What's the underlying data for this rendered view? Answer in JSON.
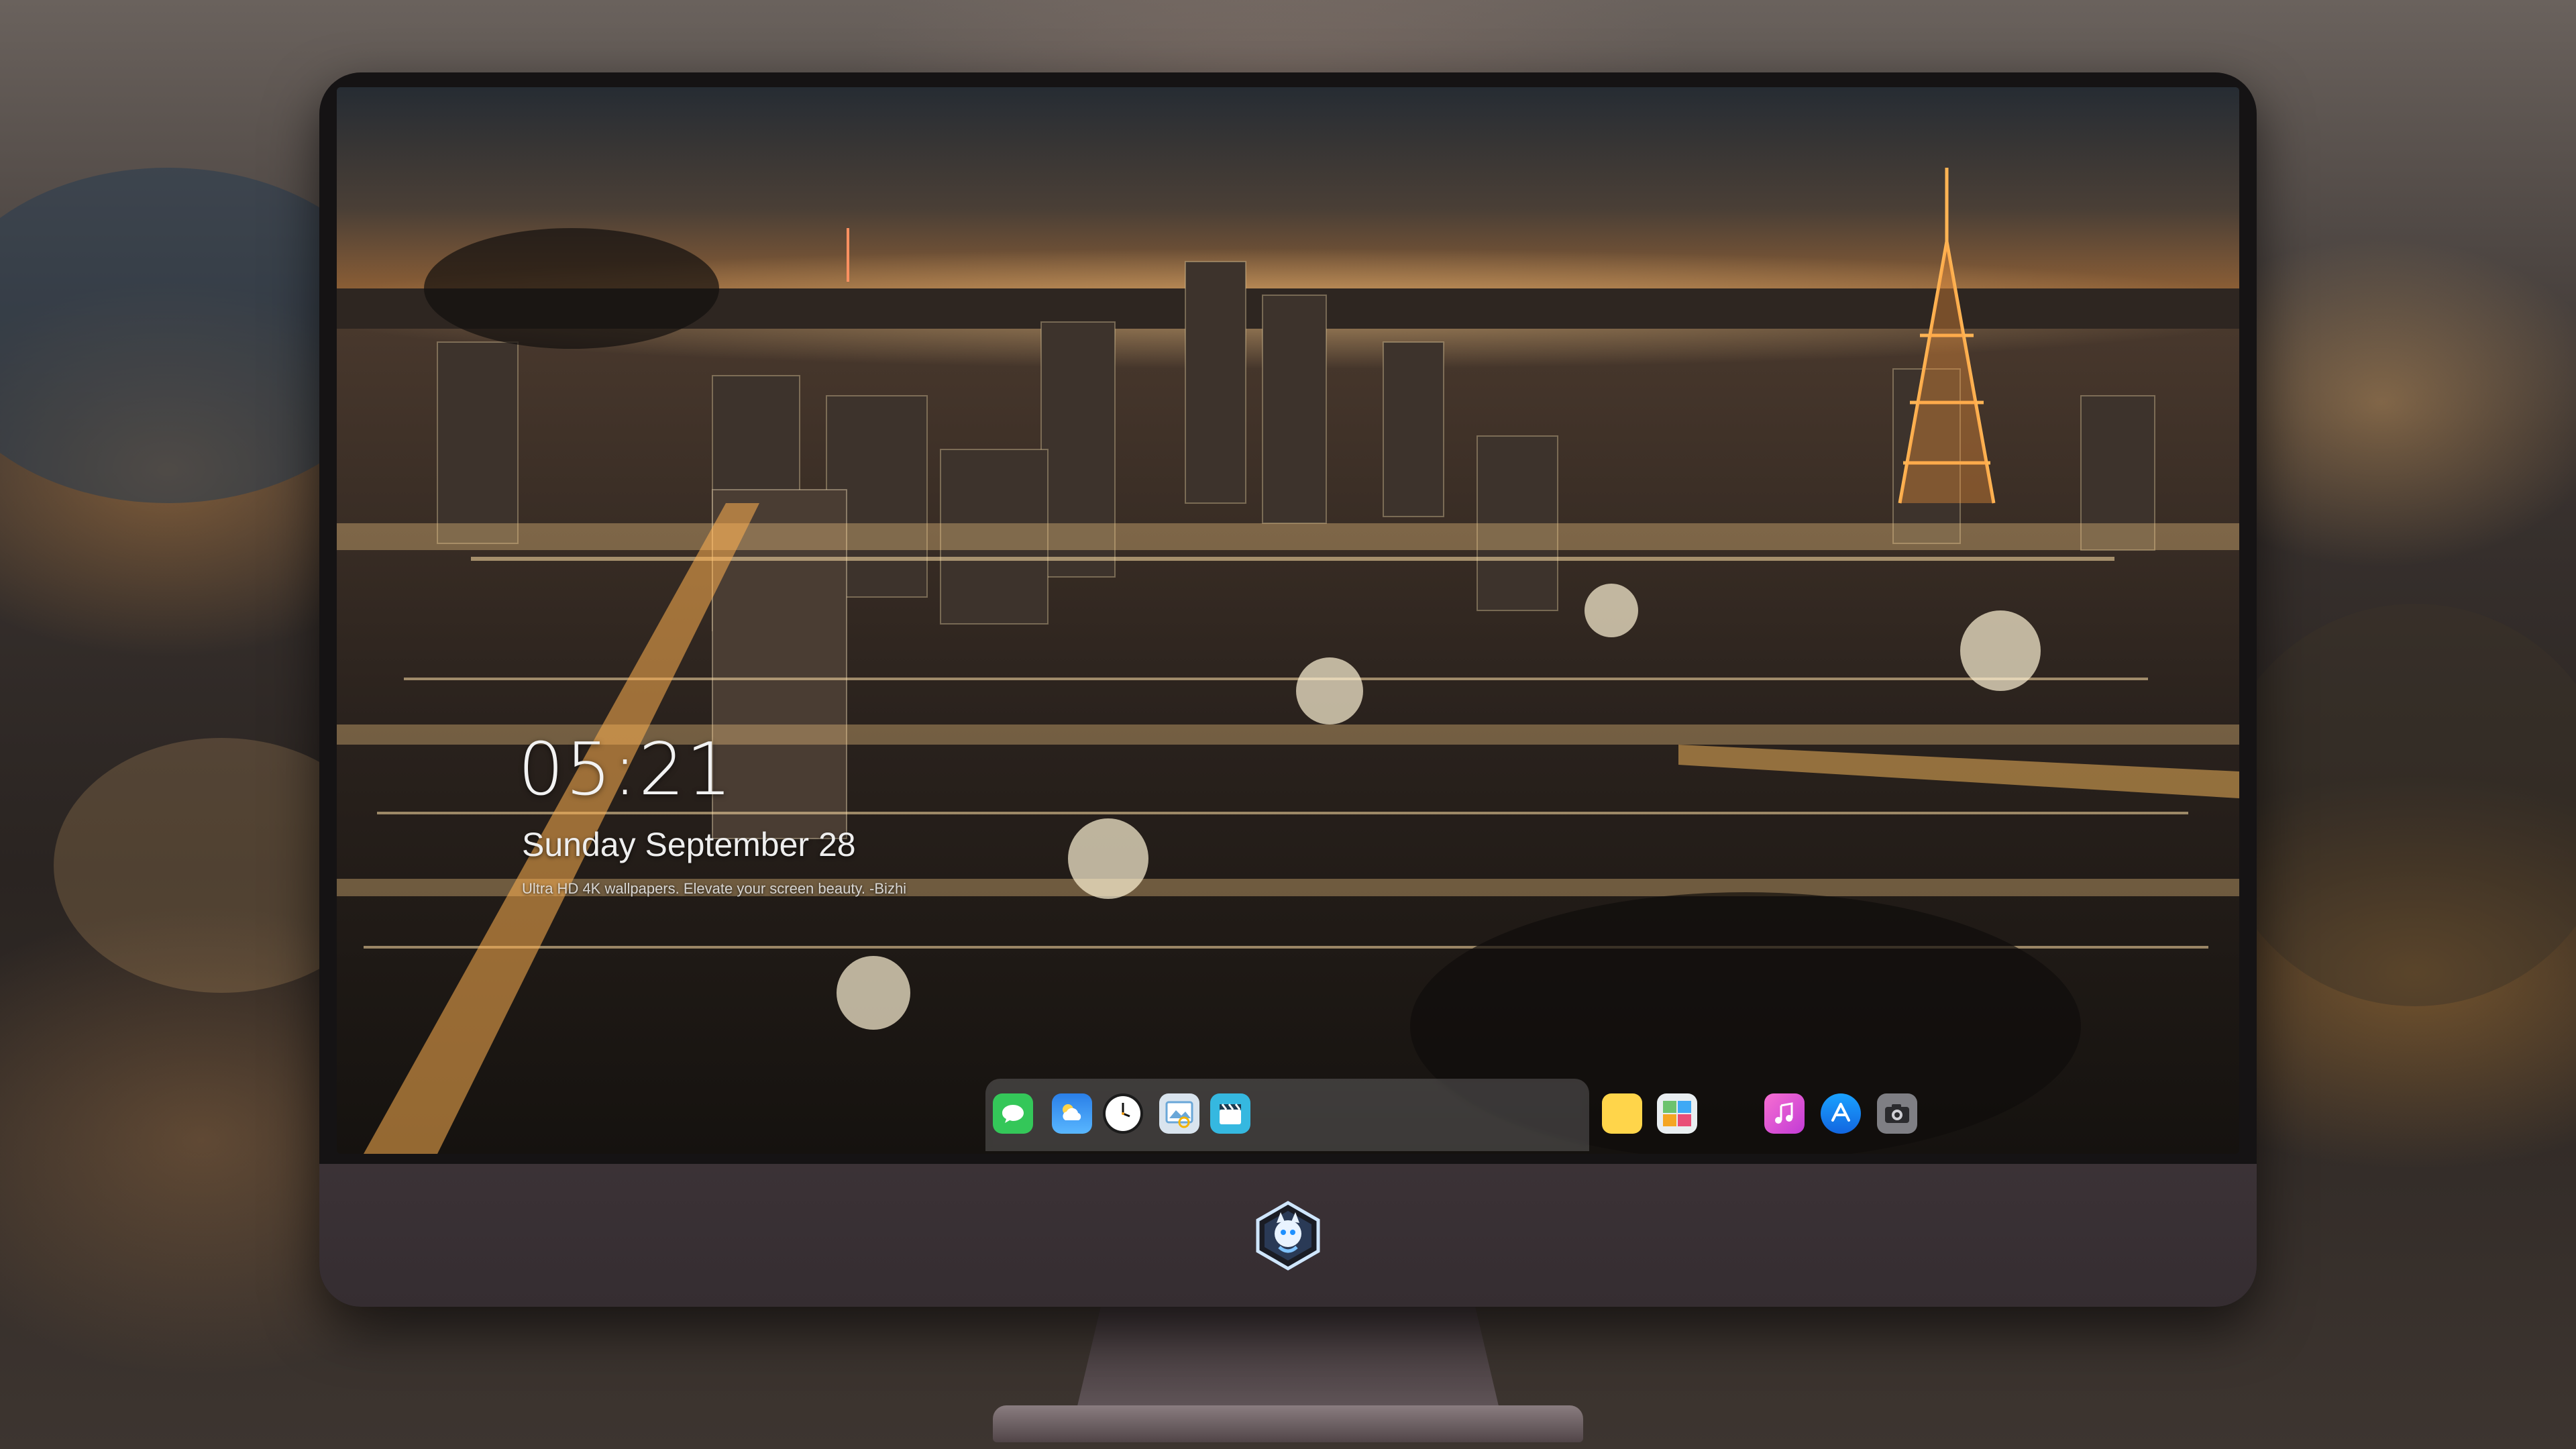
{
  "lock_screen": {
    "time": "05:21",
    "date": "Sunday September 28",
    "quote": "Ultra HD 4K wallpapers. Elevate your screen beauty. -Bizhi"
  },
  "dock": {
    "items": [
      {
        "name": "Messages",
        "icon": "messages-icon",
        "color": "#34c759"
      },
      {
        "name": "Weather",
        "icon": "weather-icon",
        "color": "#1e90ff"
      },
      {
        "name": "Clock",
        "icon": "clock-icon",
        "color": "#ffffff"
      },
      {
        "name": "Preview",
        "icon": "preview-icon",
        "color": "#6aa7d8"
      },
      {
        "name": "Clips",
        "icon": "clips-icon",
        "color": "#35b8e0"
      },
      {
        "name": "Notes",
        "icon": "notes-icon",
        "color": "#ffd54a"
      },
      {
        "name": "Photo Booth",
        "icon": "photo-booth-icon",
        "color": "#6cc36e"
      },
      {
        "name": "iTunes",
        "icon": "itunes-icon",
        "color": "#e552c6"
      },
      {
        "name": "App Store",
        "icon": "app-store-icon",
        "color": "#1f8bf2"
      },
      {
        "name": "Camera",
        "icon": "camera-icon",
        "color": "#8a8a8e"
      }
    ]
  },
  "colors": {
    "bezel": "#151314",
    "chin": "#3b3236",
    "city_glow": "#ffb860"
  }
}
